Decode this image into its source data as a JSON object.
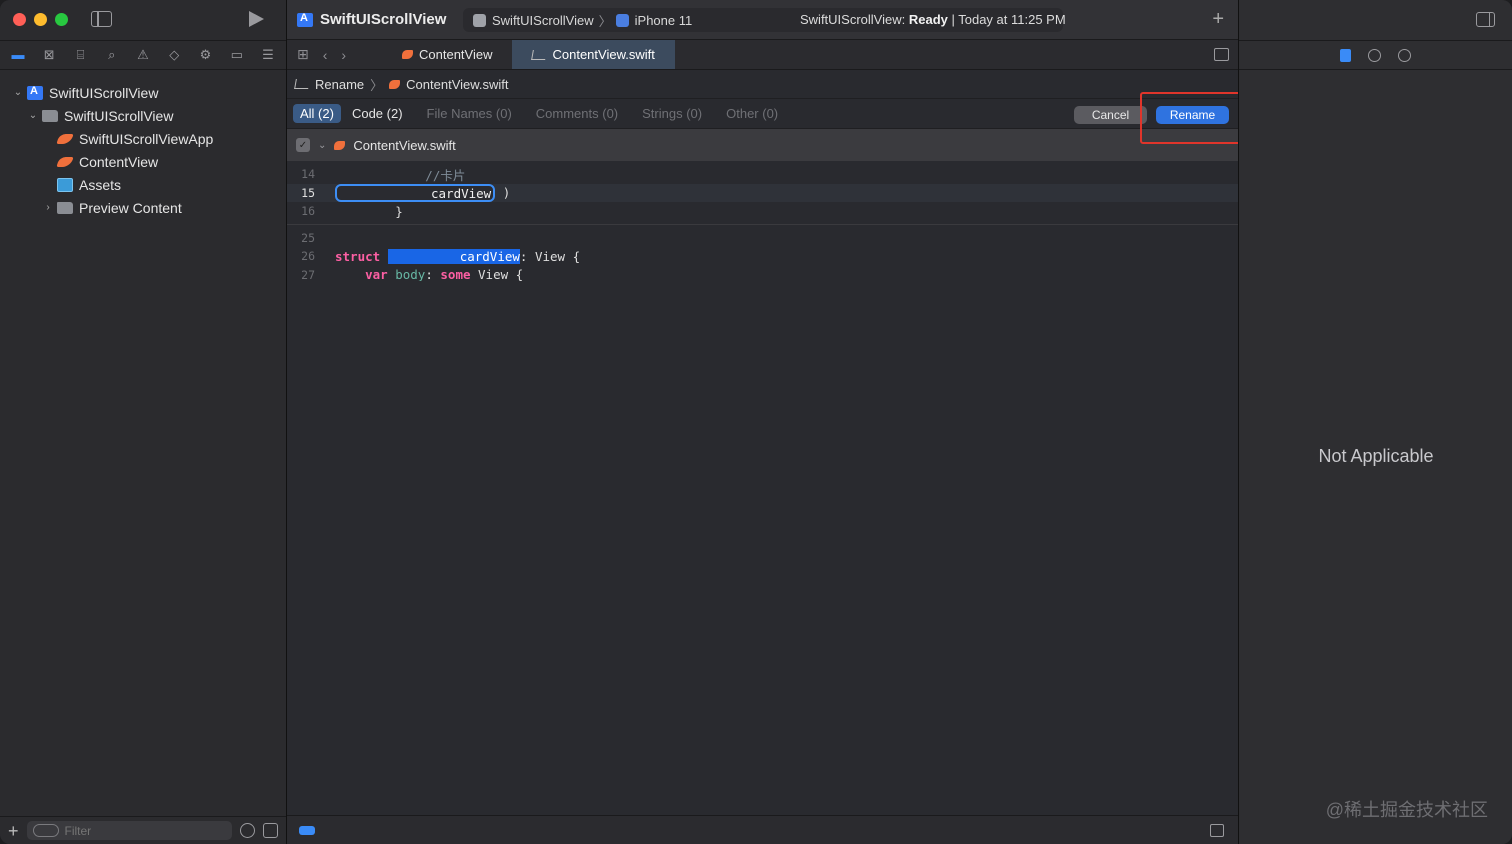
{
  "navigator": {
    "tree": [
      {
        "label": "SwiftUIScrollView",
        "icon": "project-icon",
        "indent": 0,
        "disclosure": "⌄"
      },
      {
        "label": "SwiftUIScrollView",
        "icon": "folder-icon",
        "indent": 1,
        "disclosure": "⌄"
      },
      {
        "label": "SwiftUIScrollViewApp",
        "icon": "swift-file-icon",
        "indent": 2,
        "disclosure": ""
      },
      {
        "label": "ContentView",
        "icon": "swift-file-icon",
        "indent": 2,
        "disclosure": ""
      },
      {
        "label": "Assets",
        "icon": "assets-icon",
        "indent": 2,
        "disclosure": ""
      },
      {
        "label": "Preview Content",
        "icon": "folder-icon",
        "indent": 2,
        "disclosure": "›"
      }
    ],
    "filter_placeholder": "Filter"
  },
  "toolbar": {
    "project_title": "SwiftUIScrollView",
    "scheme": "SwiftUIScrollView",
    "destination": "iPhone 11",
    "status_prefix": "SwiftUIScrollView: ",
    "status_state": "Ready",
    "status_suffix": " | Today at 11:25 PM"
  },
  "tabs": [
    {
      "label": "ContentView",
      "active": false
    },
    {
      "label": "ContentView.swift",
      "active": true
    }
  ],
  "breadcrumb": {
    "root": "Rename",
    "file": "ContentView.swift"
  },
  "rename_filters": [
    {
      "label": "All (2)",
      "active": true
    },
    {
      "label": "Code (2)",
      "active": false
    },
    {
      "label": "File Names (0)",
      "active": false
    },
    {
      "label": "Comments (0)",
      "active": false
    },
    {
      "label": "Strings (0)",
      "active": false
    },
    {
      "label": "Other (0)",
      "active": false
    }
  ],
  "buttons": {
    "cancel": "Cancel",
    "rename": "Rename"
  },
  "file_header": {
    "name": "ContentView.swift"
  },
  "code": {
    "l14_num": "14",
    "l14_text": "            //卡片",
    "l15_num": "15",
    "l15_field": "cardView",
    "l15_tail": " )",
    "l16_num": "16",
    "l16_text": "        }",
    "l25_num": "25",
    "l26_num": "26",
    "l26_kw": "struct",
    "l26_sel": "cardView",
    "l26_tail": ": View {",
    "l27_num": "27",
    "l27_kw1": "var",
    "l27_prop": "body",
    "l27_mid": ": ",
    "l27_kw2": "some",
    "l27_tail": " View {"
  },
  "inspector": {
    "empty_text": "Not Applicable"
  },
  "watermark": "@稀土掘金技术社区",
  "colors": {
    "accent": "#2f73e0",
    "highlight_box": "#e0352b",
    "keyword": "#fc5fa3",
    "selection": "#1966e6"
  }
}
